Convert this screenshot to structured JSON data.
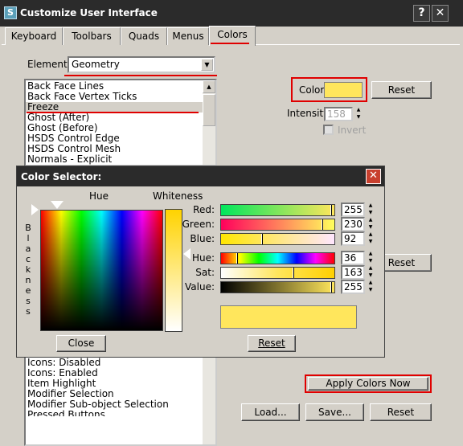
{
  "window": {
    "title": "Customize User Interface",
    "help_btn": "?",
    "close_btn": "✕",
    "icon": "S"
  },
  "tabs": [
    {
      "label": "Keyboard"
    },
    {
      "label": "Toolbars"
    },
    {
      "label": "Quads"
    },
    {
      "label": "Menus"
    },
    {
      "label": "Colors"
    }
  ],
  "elements": {
    "label": "Elements:",
    "value": "Geometry"
  },
  "list_top": [
    "Back Face Lines",
    "Back Face Vertex Ticks",
    "Freeze",
    "Ghost (After)",
    "Ghost (Before)",
    "HSDS Control Edge",
    "HSDS Control Mesh",
    "Normals - Explicit"
  ],
  "list_bottom": [
    "Icons: Disabled",
    "Icons: Enabled",
    "Item Highlight",
    "Modifier Selection",
    "Modifier Sub-object Selection",
    "Pressed Buttons"
  ],
  "color": {
    "label": "Color:",
    "swatch": "#ffe65c",
    "reset_label": "Reset"
  },
  "intensity": {
    "label": "Intensity:",
    "value": "158"
  },
  "invert_label": "Invert",
  "reset2_label": "Reset",
  "apply_label": "Apply Colors Now",
  "load_label": "Load...",
  "save_label": "Save...",
  "reset3_label": "Reset",
  "color_selector": {
    "title": "Color Selector:",
    "close": "✕",
    "hue_label": "Hue",
    "whiteness_label": "Whiteness",
    "blackness_label": "Blackness",
    "sliders": [
      {
        "label": "Red:",
        "value": "255"
      },
      {
        "label": "Green:",
        "value": "230"
      },
      {
        "label": "Blue:",
        "value": "92"
      },
      {
        "label": "Hue:",
        "value": "36"
      },
      {
        "label": "Sat:",
        "value": "163"
      },
      {
        "label": "Value:",
        "value": "255"
      }
    ],
    "close_label": "Close",
    "reset_label": "Reset"
  },
  "colors": {
    "accent_red": "#e00000",
    "selected_color": "#ffe65c"
  }
}
